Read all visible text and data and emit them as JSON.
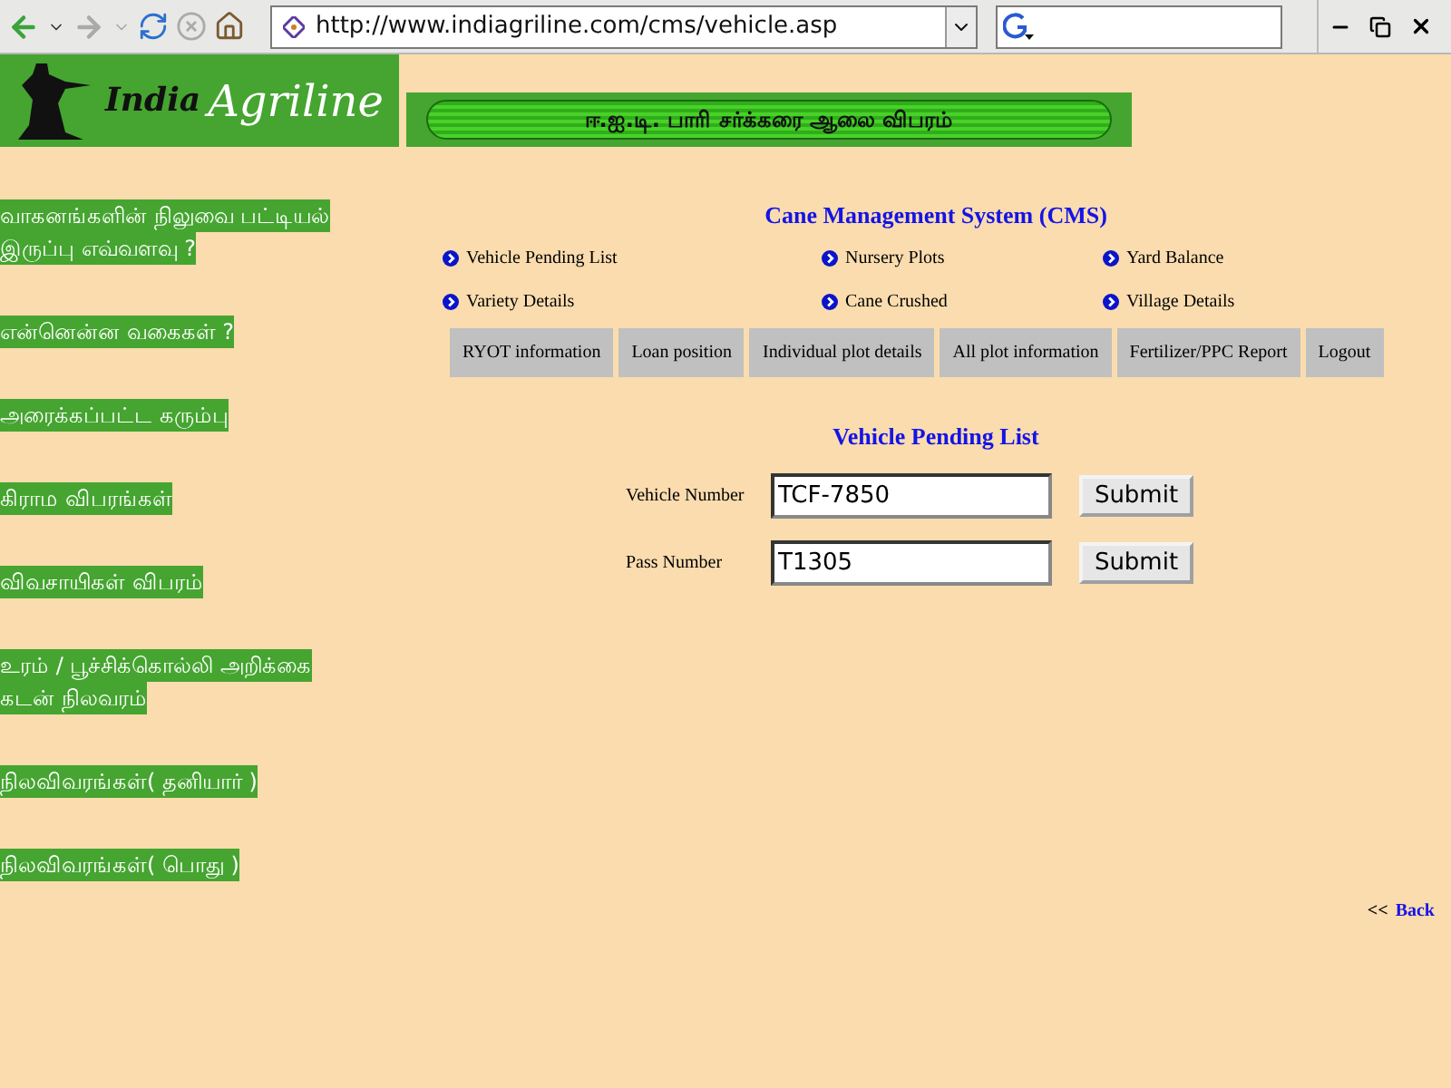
{
  "browser": {
    "url": "http://www.indiagriline.com/cms/vehicle.asp"
  },
  "logo": {
    "word_1": "India",
    "word_2": "Agriline"
  },
  "banner": {
    "title": "ஈ.ஐ.டி. பாரி சர்க்கரை ஆலை விபரம்"
  },
  "sidebar": {
    "items": [
      {
        "lines": [
          "வாகனங்களின் நிலுவை பட்டியல்",
          "இருப்பு எவ்வளவு ?"
        ]
      },
      {
        "lines": [
          "என்னென்ன வகைகள் ?"
        ]
      },
      {
        "lines": [
          "அரைக்கப்பட்ட கரும்பு"
        ]
      },
      {
        "lines": [
          "கிராம விபரங்கள்"
        ]
      },
      {
        "lines": [
          "விவசாயிகள் விபரம்"
        ]
      },
      {
        "lines": [
          "உரம் / பூச்சிக்கொல்லி அறிக்கை",
          "கடன் நிலவரம்"
        ]
      },
      {
        "lines": [
          "நிலவிவரங்கள்( தனியார் )"
        ]
      },
      {
        "lines": [
          "நிலவிவரங்கள்( பொது )"
        ]
      }
    ]
  },
  "heading": "Cane Management System (CMS)",
  "links": [
    "Vehicle Pending List",
    "Nursery Plots",
    "Yard Balance",
    "Variety Details",
    "Cane Crushed",
    "Village Details"
  ],
  "tabs": [
    "RYOT information",
    "Loan position",
    "Individual plot details",
    "All plot information",
    "Fertilizer/PPC Report",
    "Logout"
  ],
  "form": {
    "title": "Vehicle Pending List",
    "fields": [
      {
        "label": "Vehicle Number",
        "value": "TCF-7850",
        "button": "Submit"
      },
      {
        "label": "Pass Number",
        "value": "T1305",
        "button": "Submit"
      }
    ]
  },
  "back": {
    "marker": "<<",
    "label": "Back"
  }
}
